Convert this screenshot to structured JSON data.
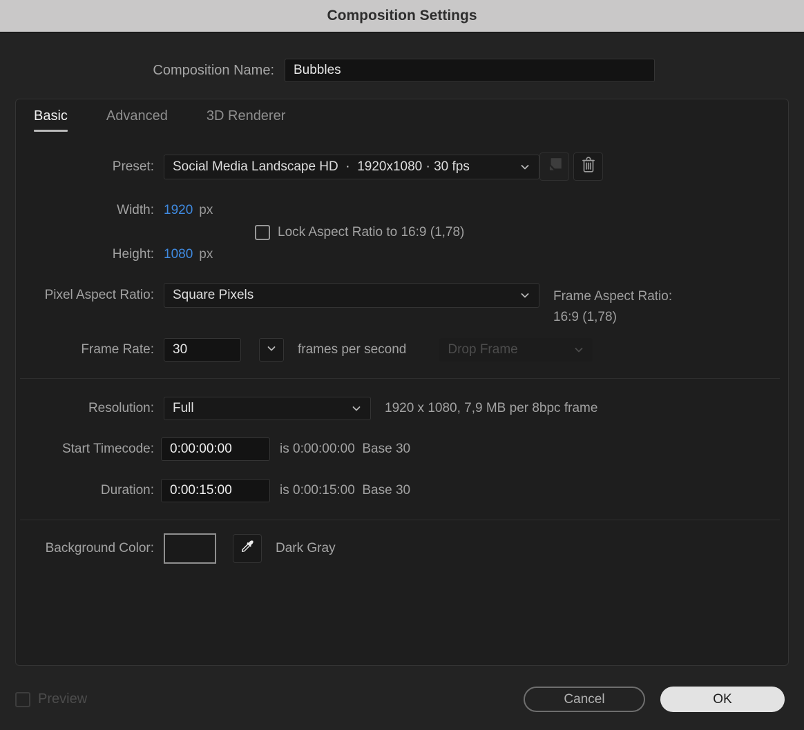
{
  "window": {
    "title": "Composition Settings"
  },
  "composition_name": {
    "label": "Composition Name:",
    "value": "Bubbles"
  },
  "tabs": [
    {
      "label": "Basic",
      "active": true
    },
    {
      "label": "Advanced",
      "active": false
    },
    {
      "label": "3D Renderer",
      "active": false
    }
  ],
  "preset": {
    "label": "Preset:",
    "value": "Social Media Landscape HD  ·  1920x1080 · 30 fps"
  },
  "dimensions": {
    "width_label": "Width:",
    "width_value": "1920",
    "width_unit": "px",
    "height_label": "Height:",
    "height_value": "1080",
    "height_unit": "px",
    "lock_label": "Lock Aspect Ratio to 16:9 (1,78)",
    "lock_checked": false
  },
  "pixel_aspect_ratio": {
    "label": "Pixel Aspect Ratio:",
    "value": "Square Pixels"
  },
  "frame_aspect_ratio": {
    "label": "Frame Aspect Ratio:",
    "value": "16:9 (1,78)"
  },
  "frame_rate": {
    "label": "Frame Rate:",
    "value": "30",
    "unit": "frames per second",
    "drop_frame_value": "Drop Frame",
    "drop_frame_enabled": false
  },
  "resolution": {
    "label": "Resolution:",
    "value": "Full",
    "info": "1920 x 1080, 7,9 MB per 8bpc frame"
  },
  "start_timecode": {
    "label": "Start Timecode:",
    "value": "0:00:00:00",
    "info": "is 0:00:00:00  Base 30"
  },
  "duration": {
    "label": "Duration:",
    "value": "0:00:15:00",
    "info": "is 0:00:15:00  Base 30"
  },
  "background_color": {
    "label": "Background Color:",
    "color_name": "Dark Gray",
    "swatch_color": "#1a1a1a"
  },
  "footer": {
    "preview_label": "Preview",
    "preview_checked": false,
    "cancel_label": "Cancel",
    "ok_label": "OK"
  },
  "colors": {
    "accent_blue": "#3f8ae0",
    "title_bar": "#c9c8c8",
    "dialog_bg": "#232323"
  }
}
